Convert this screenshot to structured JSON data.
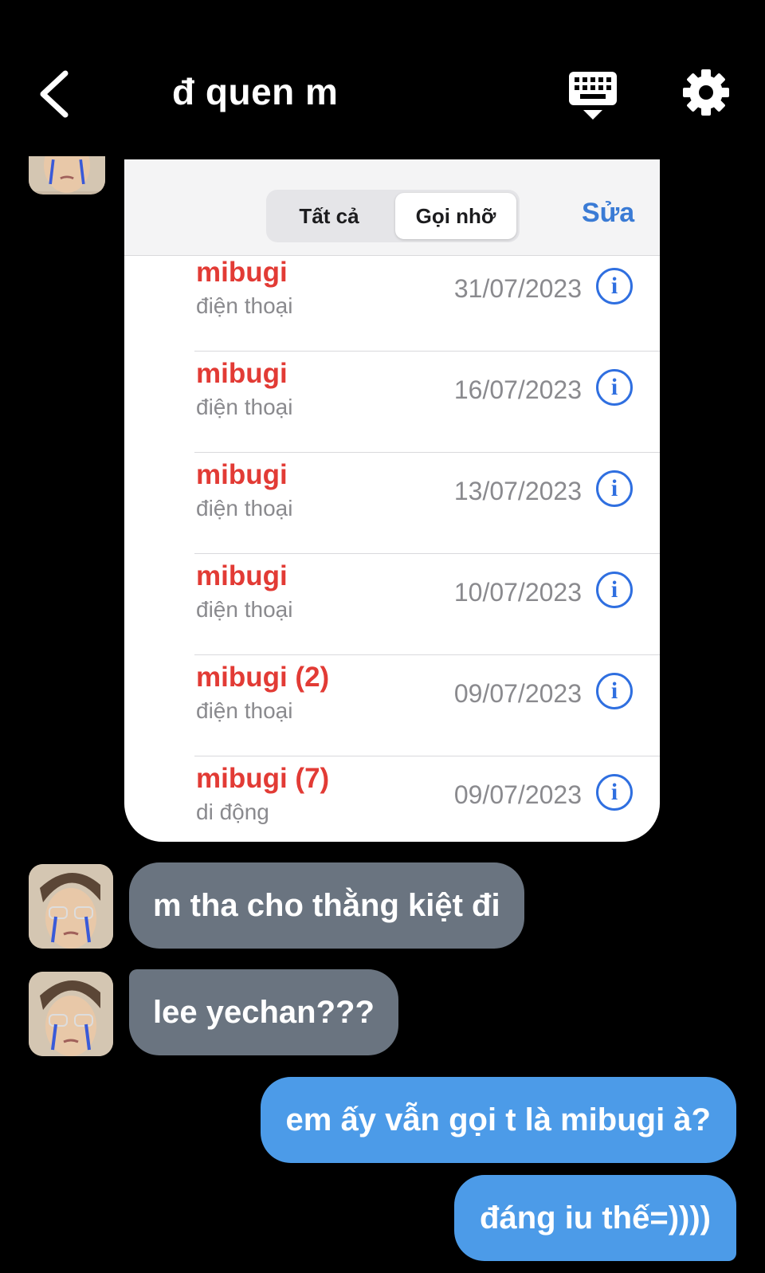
{
  "header": {
    "title": "đ quen m",
    "back_icon": "chevron-left-icon",
    "keyboard_icon": "keyboard-icon",
    "settings_icon": "gear-icon"
  },
  "call_log": {
    "tabs": [
      "Tất cả",
      "Gọi nhỡ"
    ],
    "selected_tab": "Gọi nhỡ",
    "edit_label": "Sửa",
    "info_glyph": "i",
    "rows": [
      {
        "name": "mibugi",
        "type": "điện thoại",
        "date": "31/07/2023"
      },
      {
        "name": "mibugi",
        "type": "điện thoại",
        "date": "16/07/2023"
      },
      {
        "name": "mibugi",
        "type": "điện thoại",
        "date": "13/07/2023"
      },
      {
        "name": "mibugi",
        "type": "điện thoại",
        "date": "10/07/2023"
      },
      {
        "name": "mibugi (2)",
        "type": "điện thoại",
        "date": "09/07/2023"
      },
      {
        "name": "mibugi (7)",
        "type": "di động",
        "date": "09/07/2023"
      }
    ]
  },
  "messages": [
    {
      "from": "them",
      "text": "m tha cho thằng kiệt đi"
    },
    {
      "from": "them",
      "text": "lee yechan???"
    },
    {
      "from": "me",
      "text": "em ấy vẫn gọi t là mibugi à?"
    },
    {
      "from": "me",
      "text": "đáng iu thế=))))"
    }
  ],
  "colors": {
    "background": "#000000",
    "incoming_bubble": "#6a7480",
    "outgoing_bubble": "#4c9be8",
    "missed_call": "#e23b35",
    "ios_blue": "#2f6fe0"
  }
}
